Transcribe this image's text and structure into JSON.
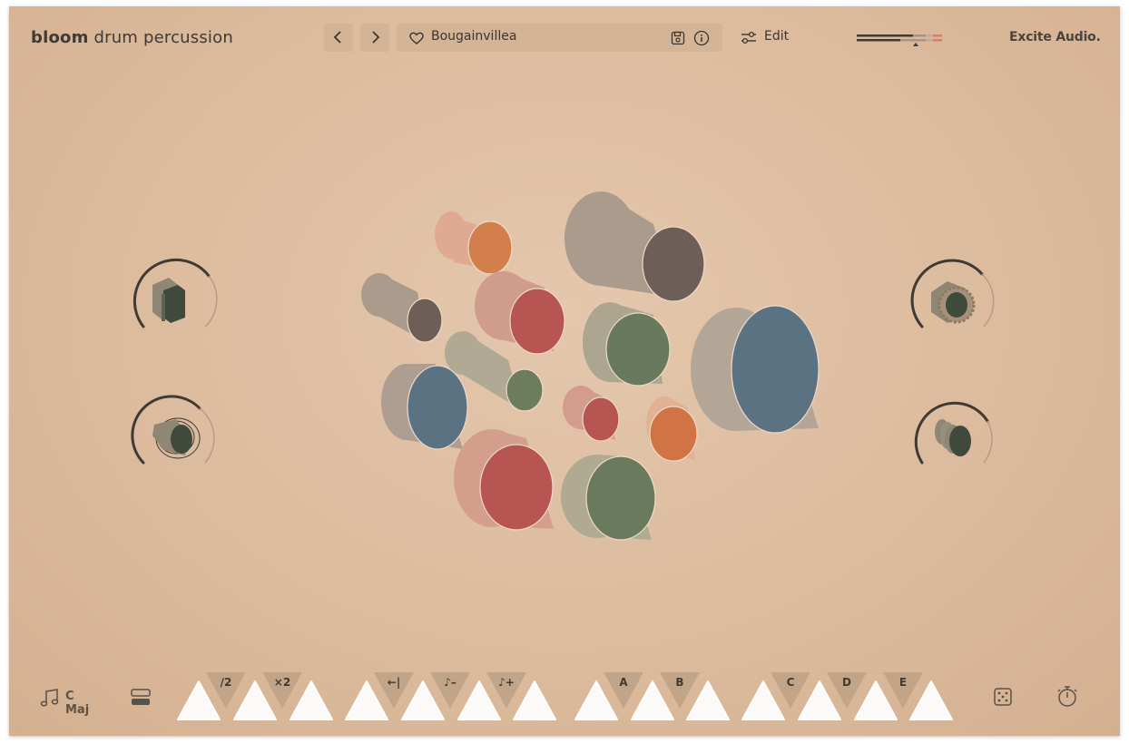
{
  "header": {
    "brand_bold": "bloom",
    "brand_rest": "drum percussion",
    "prev_icon": "chevron-left-icon",
    "next_icon": "chevron-right-icon",
    "preset_name": "Bougainvillea",
    "favorite_icon": "heart-icon",
    "save_icon": "save-icon",
    "info_icon": "info-icon",
    "edit_label": "Edit",
    "edit_icon": "sliders-icon",
    "logo": "Excite Audio."
  },
  "knobs": {
    "top_left_icon": "cube-distortion-icon",
    "bottom_left_icon": "ripple-cylinder-icon",
    "top_right_icon": "gear-cylinder-icon",
    "bottom_right_icon": "echo-cylinder-icon"
  },
  "bottom": {
    "scale_icon": "music-note-icon",
    "scale_label": "C Maj",
    "layout_icon": "layout-rows-icon",
    "tabs": [
      {
        "label": "/2"
      },
      {
        "label": "×2"
      },
      {
        "label": "←|"
      },
      {
        "label": "♪–"
      },
      {
        "label": "♪+"
      },
      {
        "label": "A"
      },
      {
        "label": "B"
      },
      {
        "label": "C"
      },
      {
        "label": "D"
      },
      {
        "label": "E"
      }
    ],
    "dice_icon": "dice-icon",
    "timer_icon": "stopwatch-icon"
  },
  "colors": {
    "background": "#dcbb9e",
    "dark": "#3f3a33",
    "pad": "#fbfaf8",
    "tab": "#c2a588"
  }
}
